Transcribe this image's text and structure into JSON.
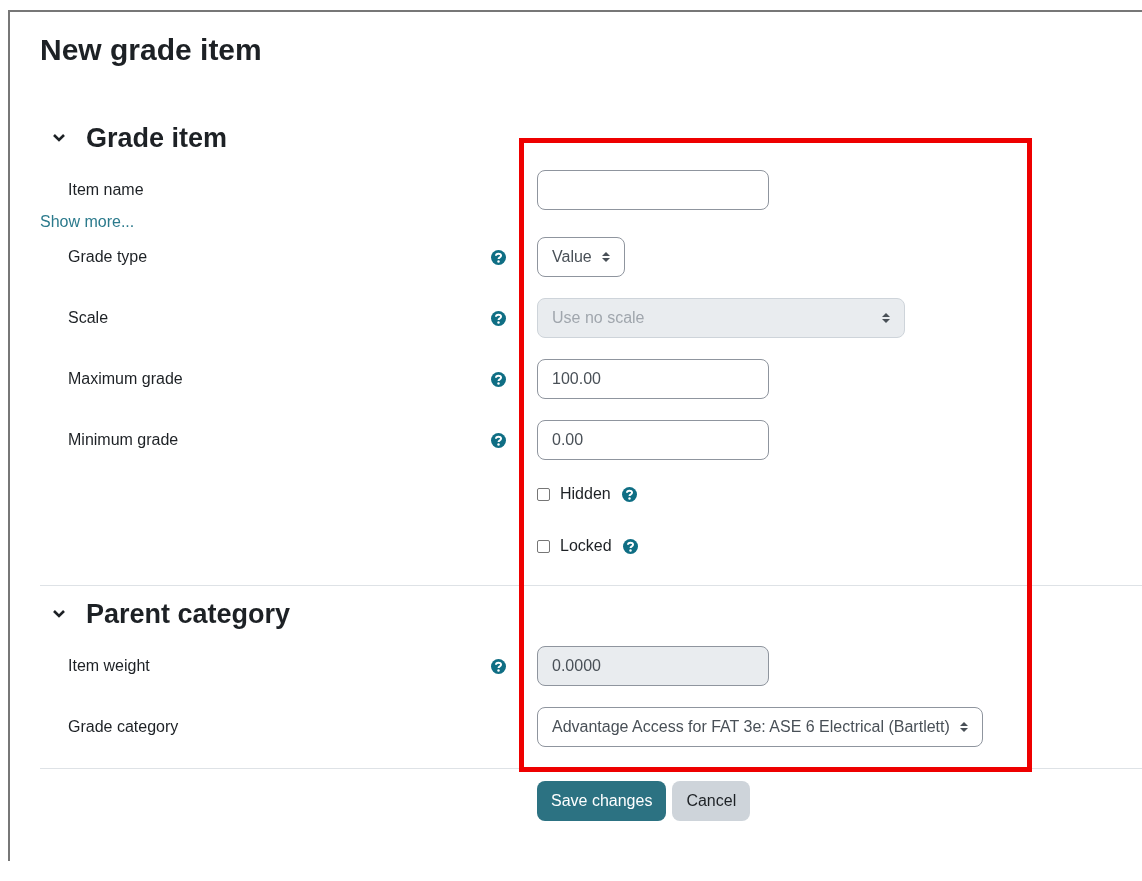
{
  "title": "New grade item",
  "sections": [
    {
      "title": "Grade item",
      "expanded": true,
      "rows": [
        {
          "kind": "text",
          "label": "Item name",
          "help": false,
          "disabled": false
        },
        {
          "kind": "link",
          "label": "Show more..."
        },
        {
          "kind": "select",
          "label": "Grade type",
          "value": "Value",
          "help": true,
          "disabled": false
        },
        {
          "kind": "select",
          "label": "Scale",
          "value": "Use no scale",
          "help": true,
          "disabled": true
        },
        {
          "kind": "text",
          "label": "Maximum grade",
          "value": "100.00",
          "help": true,
          "disabled": false
        },
        {
          "kind": "text",
          "label": "Minimum grade",
          "value": "0.00",
          "help": true,
          "disabled": false
        },
        {
          "kind": "checkbox",
          "label": "Hidden",
          "checked": false,
          "help": true
        },
        {
          "kind": "checkbox",
          "label": "Locked",
          "checked": false,
          "help": true
        }
      ]
    },
    {
      "title": "Parent category",
      "expanded": true,
      "rows": [
        {
          "kind": "text",
          "label": "Item weight",
          "value": "0.0000",
          "help": true,
          "disabled": true
        },
        {
          "kind": "select",
          "label": "Grade category",
          "value": "Advantage Access for FAT 3e: ASE 6 Electrical (Bartlett)",
          "help": false,
          "disabled": false
        }
      ]
    }
  ],
  "buttons": [
    {
      "label": "Save changes",
      "kind": "primary"
    },
    {
      "label": "Cancel",
      "kind": "secondary"
    }
  ]
}
